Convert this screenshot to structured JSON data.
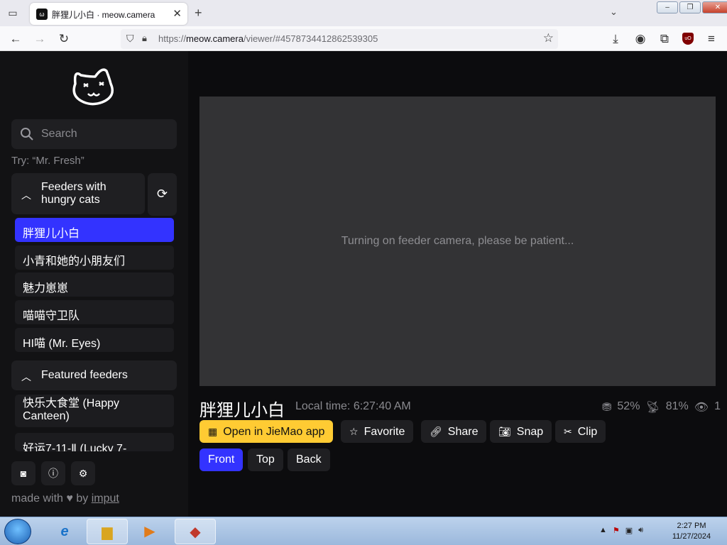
{
  "browser": {
    "tab_title": "胖狸儿小白 · meow.camera",
    "url_prefix": "https://",
    "url_host": "meow.camera",
    "url_path": "/viewer/#4578734412862539305"
  },
  "sidebar": {
    "search_placeholder": "Search",
    "try_hint": "Try: “Mr. Fresh”",
    "section_hungry": "Feeders with hungry cats",
    "hungry_items": [
      "胖狸儿小白",
      "小青和她的小朋友们",
      "魅力崽崽",
      "喵喵守卫队",
      "HI喵 (Mr. Eyes)"
    ],
    "section_featured": "Featured feeders",
    "featured_items": [
      "快乐大食堂 (Happy Canteen)",
      "好运7-11-Ⅱ (Lucky 7-"
    ],
    "made_with_prefix": "made with",
    "made_with_by": "by",
    "made_with_link": "imput"
  },
  "main": {
    "video_status": "Turning on feeder camera, please be patient...",
    "camera_title": "胖狸儿小白",
    "local_time": "Local time: 6:27:40 AM",
    "food_level": "52%",
    "signal": "81%",
    "viewers": "1",
    "buttons": {
      "open_app": "Open in JieMao app",
      "favorite": "Favorite",
      "share": "Share",
      "snap": "Snap",
      "clip": "Clip"
    },
    "views": [
      "Front",
      "Top",
      "Back"
    ],
    "active_view": "Front"
  },
  "taskbar": {
    "time": "2:27 PM",
    "date": "11/27/2024"
  },
  "colors": {
    "accent": "#3333ff",
    "app_button": "#ffcb33",
    "background": "#0c0c0e"
  }
}
